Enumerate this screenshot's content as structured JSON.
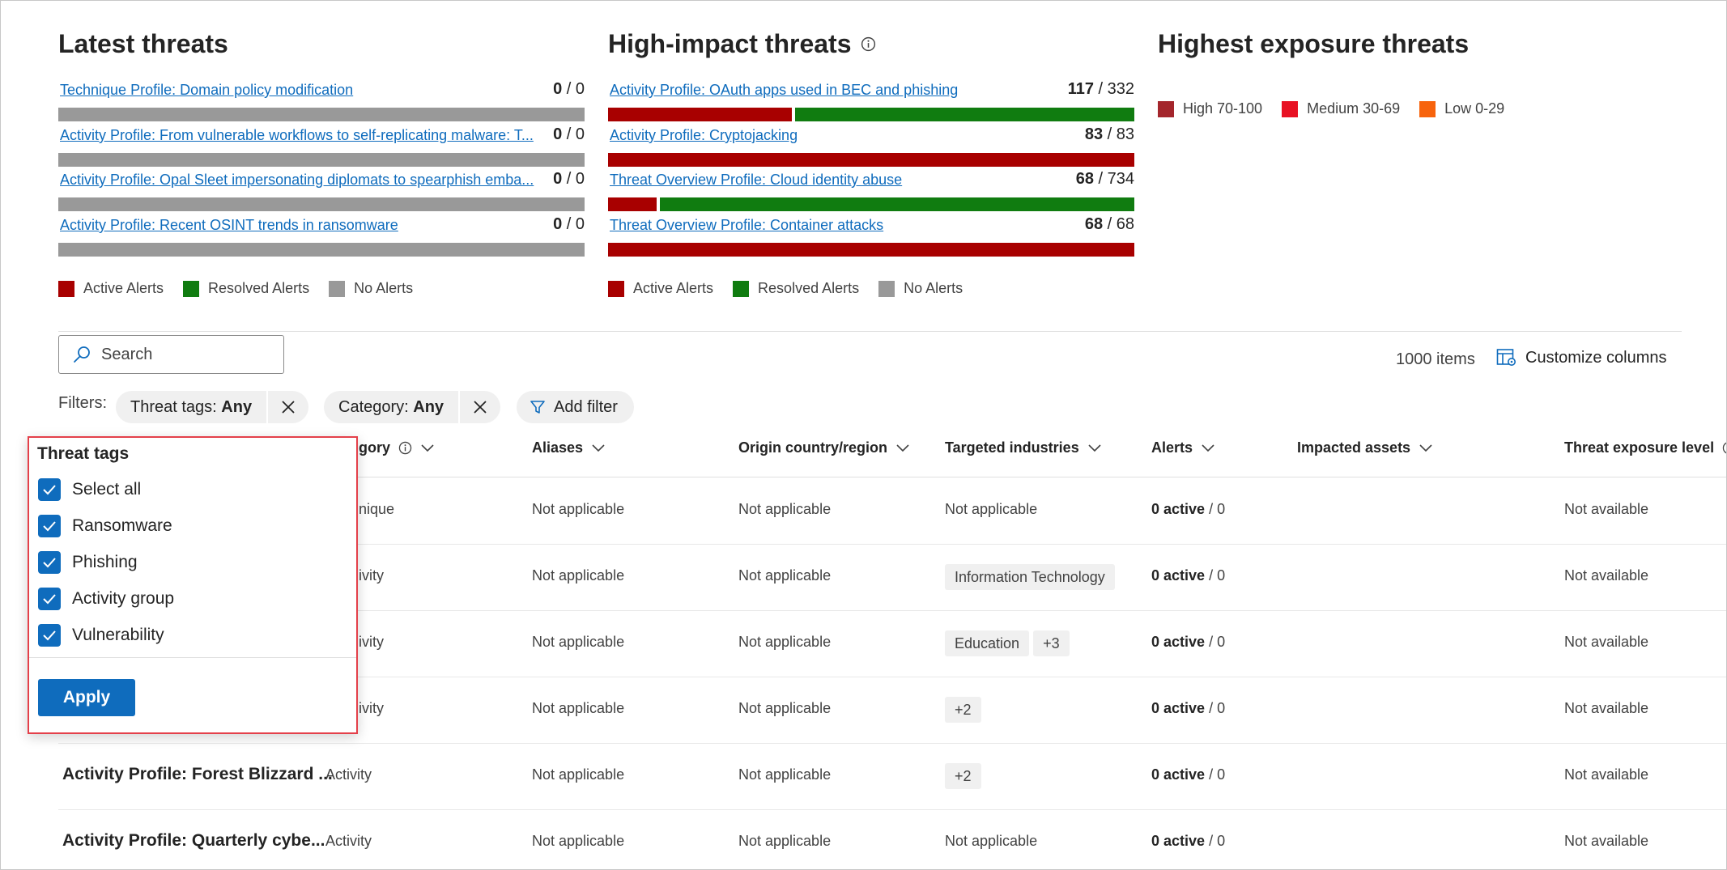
{
  "latest": {
    "title": "Latest threats",
    "rows": [
      {
        "label": "Technique Profile: Domain policy modification",
        "count_bold": "0",
        "count_rest": " / 0"
      },
      {
        "label": "Activity Profile: From vulnerable workflows to self-replicating malware: T...",
        "count_bold": "0",
        "count_rest": " / 0"
      },
      {
        "label": "Activity Profile: Opal Sleet impersonating diplomats to spearphish emba...",
        "count_bold": "0",
        "count_rest": " / 0"
      },
      {
        "label": "Activity Profile: Recent OSINT trends in ransomware",
        "count_bold": "0",
        "count_rest": " / 0"
      }
    ],
    "legend": [
      "Active Alerts",
      "Resolved Alerts",
      "No Alerts"
    ]
  },
  "high_impact": {
    "title": "High-impact threats",
    "rows": [
      {
        "label": "Activity Profile: OAuth apps used in BEC and phishing",
        "count_bold": "117",
        "count_rest": " / 332",
        "active_fraction": 0.352
      },
      {
        "label": "Activity Profile: Cryptojacking",
        "count_bold": "83",
        "count_rest": " / 83",
        "active_fraction": 1.0
      },
      {
        "label": "Threat Overview Profile: Cloud identity abuse",
        "count_bold": "68",
        "count_rest": " / 734",
        "active_fraction": 0.093
      },
      {
        "label": "Threat Overview Profile: Container attacks",
        "count_bold": "68",
        "count_rest": " / 68",
        "active_fraction": 1.0
      }
    ],
    "legend": [
      "Active Alerts",
      "Resolved Alerts",
      "No Alerts"
    ]
  },
  "exposure": {
    "title": "Highest exposure threats",
    "legend": [
      "High 70-100",
      "Medium 30-69",
      "Low 0-29"
    ]
  },
  "colors": {
    "active": "#a80000",
    "resolved": "#107c10",
    "none": "#999999",
    "high": "#a4262c",
    "medium": "#e81123",
    "low": "#f7630c",
    "accent": "#0f6cbd"
  },
  "toolbar": {
    "search_placeholder": "Search",
    "items_count": "1000 items",
    "customize": "Customize columns",
    "filters_label": "Filters:",
    "chip1_key": "Threat tags: ",
    "chip1_val": "Any",
    "chip2_key": "Category: ",
    "chip2_val": "Any",
    "add_filter": "Add filter"
  },
  "table": {
    "headers": [
      "gory",
      "Aliases",
      "Origin country/region",
      "Targeted industries",
      "Alerts",
      "Impacted assets",
      "Threat exposure level"
    ],
    "rows": [
      {
        "name": "",
        "category": "nique",
        "aliases": "Not applicable",
        "origin": "Not applicable",
        "industries_text": "Not applicable",
        "tags": [],
        "alerts_bold": "0 active",
        "alerts_rest": " / 0",
        "exposure": "Not available"
      },
      {
        "name": "",
        "category": "ivity",
        "aliases": "Not applicable",
        "origin": "Not applicable",
        "industries_text": "",
        "tags": [
          "Information Technology"
        ],
        "alerts_bold": "0 active",
        "alerts_rest": " / 0",
        "exposure": "Not available"
      },
      {
        "name": "",
        "category": "ivity",
        "aliases": "Not applicable",
        "origin": "Not applicable",
        "industries_text": "",
        "tags": [
          "Education",
          "+3"
        ],
        "alerts_bold": "0 active",
        "alerts_rest": " / 0",
        "exposure": "Not available"
      },
      {
        "name": "",
        "category": "ivity",
        "aliases": "Not applicable",
        "origin": "Not applicable",
        "industries_text": "",
        "tags": [
          "+2"
        ],
        "alerts_bold": "0 active",
        "alerts_rest": " / 0",
        "exposure": "Not available"
      },
      {
        "name": "Activity Profile: Forest Blizzard ...",
        "category": "Activity",
        "aliases": "Not applicable",
        "origin": "Not applicable",
        "industries_text": "",
        "tags": [
          "+2"
        ],
        "alerts_bold": "0 active",
        "alerts_rest": " / 0",
        "exposure": "Not available"
      },
      {
        "name": "Activity Profile: Quarterly cybe...",
        "category": "Activity",
        "aliases": "Not applicable",
        "origin": "Not applicable",
        "industries_text": "Not applicable",
        "tags": [],
        "alerts_bold": "0 active",
        "alerts_rest": " / 0",
        "exposure": "Not available"
      }
    ]
  },
  "popover": {
    "title": "Threat tags",
    "options": [
      {
        "label": "Select all",
        "checked": true
      },
      {
        "label": "Ransomware",
        "checked": true
      },
      {
        "label": "Phishing",
        "checked": true
      },
      {
        "label": "Activity group",
        "checked": true
      },
      {
        "label": "Vulnerability",
        "checked": true
      }
    ],
    "apply": "Apply"
  }
}
